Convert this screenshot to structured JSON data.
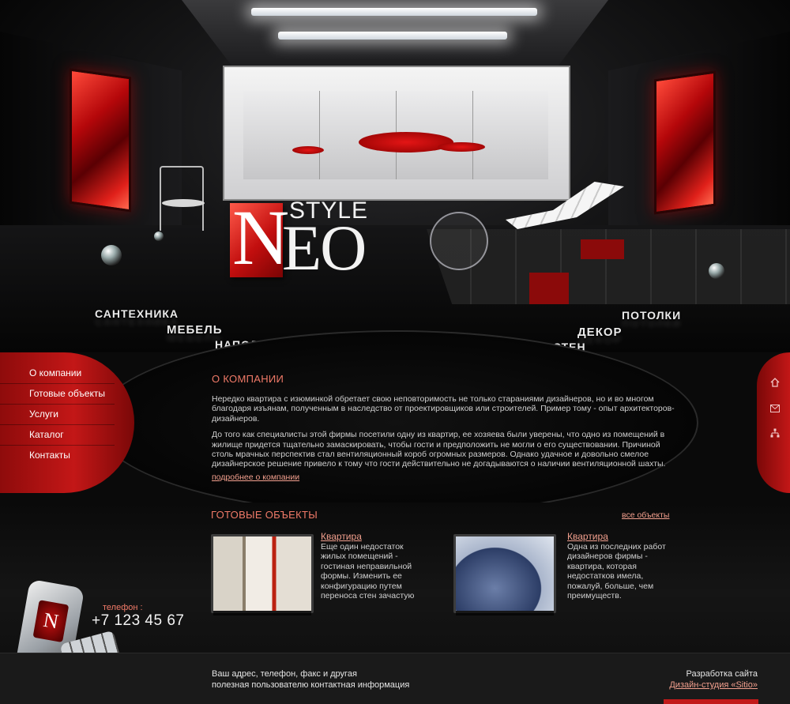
{
  "logo": {
    "letter": "N",
    "rest": "EO",
    "style": "STYLE"
  },
  "nav": {
    "santehnika": "САНТЕХНИКА",
    "mebel": "МЕБЕЛЬ",
    "napolnye": "НАПОЛЬНЫЕ ПОКРЫТИЯ",
    "pokrytiya_sten": "ПОКРЫТИЯ ДЛЯ СТЕН",
    "dekor": "ДЕКОР",
    "potolki": "ПОТОЛКИ"
  },
  "sidebar": {
    "items": [
      {
        "label": "О компании"
      },
      {
        "label": "Готовые объекты"
      },
      {
        "label": "Услуги"
      },
      {
        "label": "Каталог"
      },
      {
        "label": "Контакты"
      }
    ]
  },
  "right_icons": [
    "home-icon",
    "mail-icon",
    "sitemap-icon"
  ],
  "about": {
    "title": "О КОМПАНИИ",
    "p1": "Нередко квартира с изюминкой обретает свою неповторимость не только стараниями дизайнеров, но и во многом благодаря изъянам, полученным в наследство от проектировщиков или строителей. Пример тому - опыт архитекторов-дизайнеров.",
    "p2": "До того как специалисты этой фирмы посетили одну из квартир, ее хозяева были уверены, что одно из помещений в жилище придется тщательно замаскировать, чтобы гости и предположить не могли о его существовании. Причиной столь мрачных перспектив стал вентиляционный короб огромных размеров. Однако удачное и довольно смелое дизайнерское решение привело к тому что гости действительно не догадываются о наличии вентиляционной шахты.",
    "more": "подробнее о компании"
  },
  "objects": {
    "title": "ГОТОВЫЕ ОБЪЕКТЫ",
    "all_link": "все объекты",
    "cards": [
      {
        "title": "Квартира",
        "text": "Еще один  недостаток жилых помещений - гостиная неправильной формы. Изменить ее конфигурацию путем переноса стен зачастую"
      },
      {
        "title": "Квартира",
        "text": "Одна из последних работ дизайнеров фирмы - квартира, которая недостатков имела, пожалуй, больше, чем преимуществ."
      }
    ]
  },
  "contact": {
    "phone_label": "телефон :",
    "phone_number": "+7 123 45 67",
    "phone_icon_letter": "N"
  },
  "footer": {
    "address_line1": "Ваш адрес, телефон, факс и другая",
    "address_line2": "полезная пользователю контактная информация",
    "dev_label": "Разработка сайта",
    "studio": "Дизайн-студия «Sitio»"
  },
  "colors": {
    "accent_red": "#c31717",
    "link": "#f3a08e",
    "heading": "#f07a68",
    "background": "#0b0b0c"
  }
}
